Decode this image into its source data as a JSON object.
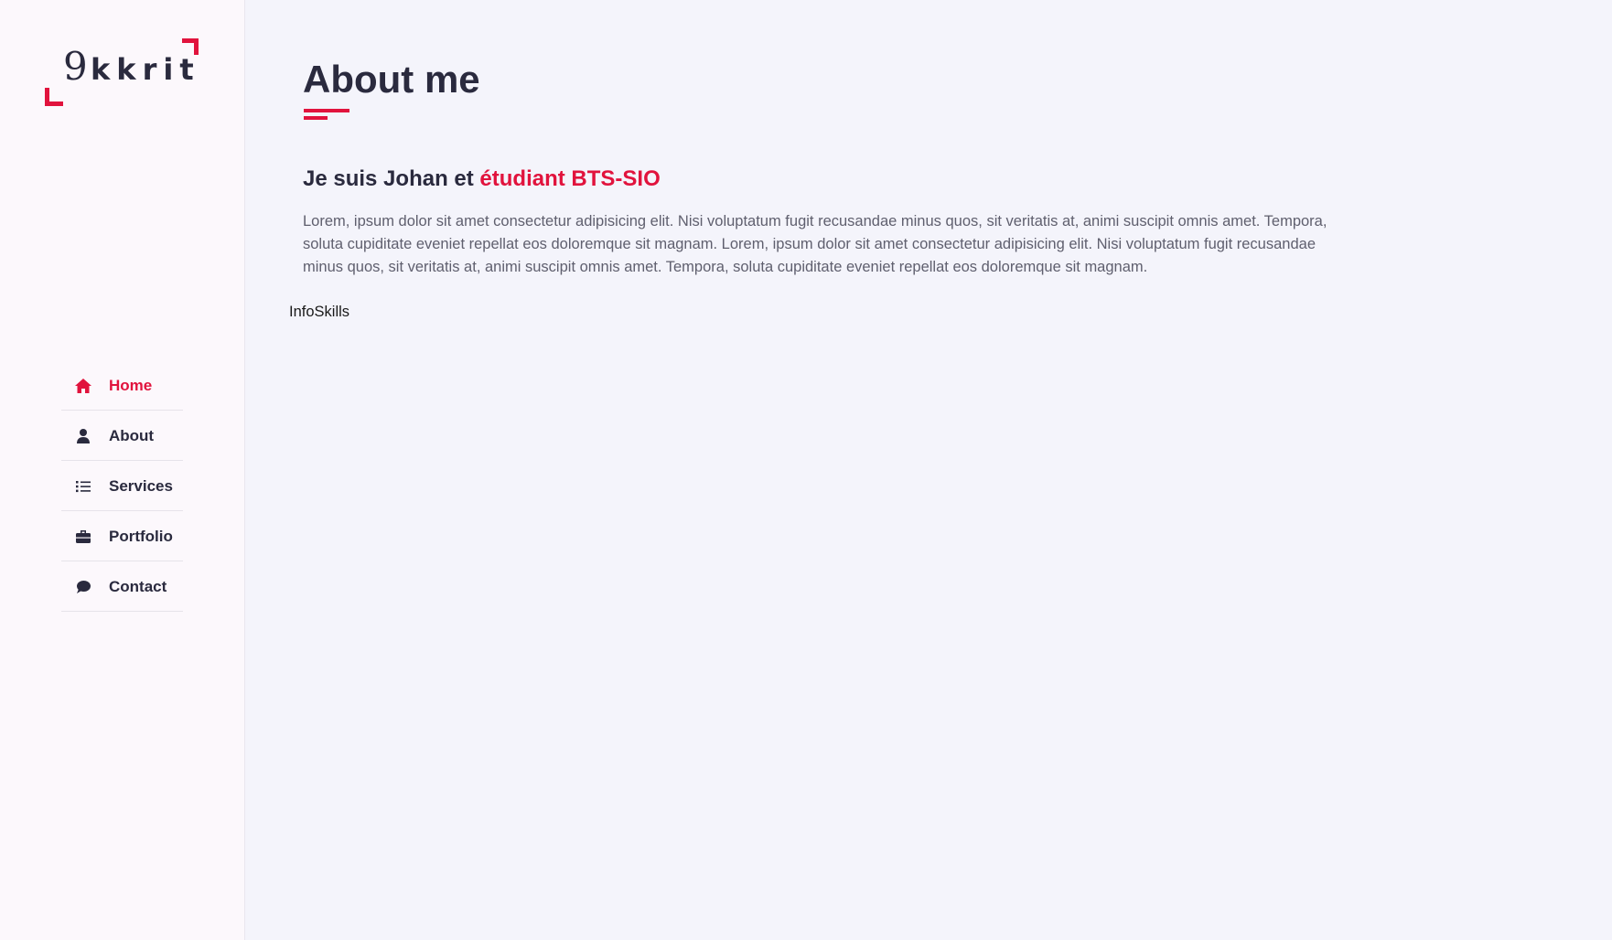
{
  "logo": {
    "digit": "9",
    "text": "kkrit",
    "accent_color": "#e1133d"
  },
  "nav": {
    "items": [
      {
        "label": "Home",
        "icon": "home-icon",
        "active": true
      },
      {
        "label": "About",
        "icon": "user-icon",
        "active": false
      },
      {
        "label": "Services",
        "icon": "list-icon",
        "active": false
      },
      {
        "label": "Portfolio",
        "icon": "briefcase-icon",
        "active": false
      },
      {
        "label": "Contact",
        "icon": "chat-bubble-icon",
        "active": false
      }
    ]
  },
  "main": {
    "title": "About me",
    "subtitle_prefix": "Je suis Johan et ",
    "subtitle_accent": "étudiant BTS-SIO",
    "description": "Lorem, ipsum dolor sit amet consectetur adipisicing elit. Nisi voluptatum fugit recusandae minus quos, sit veritatis at, animi suscipit omnis amet. Tempora, soluta cupiditate eveniet repellat eos doloremque sit magnam. Lorem, ipsum dolor sit amet consectetur adipisicing elit. Nisi voluptatum fugit recusandae minus quos, sit veritatis at, animi suscipit omnis amet. Tempora, soluta cupiditate eveniet repellat eos doloremque sit magnam.",
    "tabs": [
      "Info",
      "Skills"
    ]
  },
  "colors": {
    "accent": "#e1133d",
    "text_dark": "#2a2a3e",
    "text_muted": "#5f5f6e",
    "main_bg": "#f4f4fb",
    "sidebar_bg": "#fcf8fc"
  }
}
